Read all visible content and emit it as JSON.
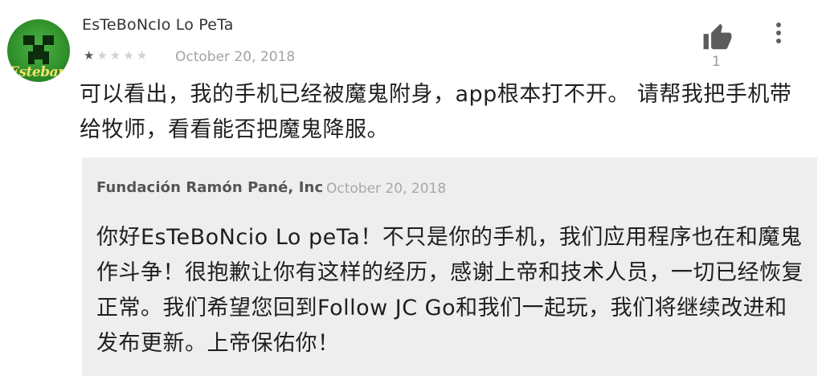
{
  "review": {
    "author": "EsTeBoNcIo Lo PeTa",
    "avatar_caption": "Esteban",
    "rating": 1,
    "rating_max": 5,
    "date": "October 20, 2018",
    "helpful_count": "1",
    "text": "可以看出，我的手机已经被魔鬼附身，app根本打不开。 请帮我把手机带给牧师，看看能否把魔鬼降服。"
  },
  "developer_reply": {
    "author": "Fundación Ramón Pané, Inc",
    "date": "October 20, 2018",
    "text": "你好EsTeBoNcio Lo peTa！不只是你的手机，我们应用程序也在和魔鬼作斗争！很抱歉让你有这样的经历，感谢上帝和技术人员，一切已经恢复正常。我们希望您回到Follow JC Go和我们一起玩，我们将继续改进和发布更新。上帝保佑你！"
  },
  "icons": {
    "thumb": "thumbs-up-icon",
    "more": "more-vert-icon",
    "star": "star-icon"
  },
  "colors": {
    "reply_background": "#eeeeee",
    "star_filled": "#5a5a5a",
    "star_empty": "#d2d2d2"
  }
}
